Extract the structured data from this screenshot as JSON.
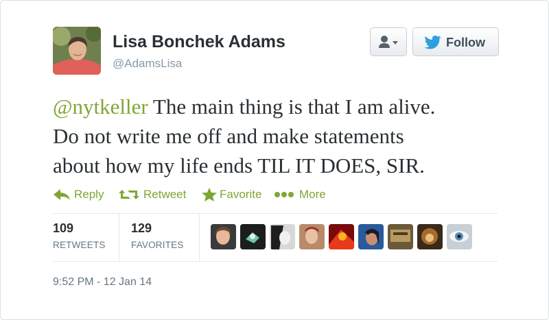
{
  "author": {
    "name": "Lisa Bonchek Adams",
    "handle": "@AdamsLisa"
  },
  "header": {
    "follow_label": "Follow",
    "user_menu_icon": "user-dropdown-icon",
    "follow_icon": "twitter-bird-icon"
  },
  "tweet": {
    "mention": "@nytkeller",
    "line1": " The main thing is that I am alive.",
    "line2": "Do not write me off and make statements",
    "line3": "about how my life ends TIL IT DOES, SIR."
  },
  "actions": {
    "reply": "Reply",
    "retweet": "Retweet",
    "favorite": "Favorite",
    "more": "More"
  },
  "stats": {
    "retweets_count": "109",
    "retweets_label": "RETWEETS",
    "favorites_count": "129",
    "favorites_label": "FAVORITES"
  },
  "timestamp": "9:52 PM - 12 Jan 14",
  "colors": {
    "accent": "#7ea632",
    "text": "#292f33",
    "muted": "#8899a6",
    "twitter_blue": "#2f9fe0"
  }
}
